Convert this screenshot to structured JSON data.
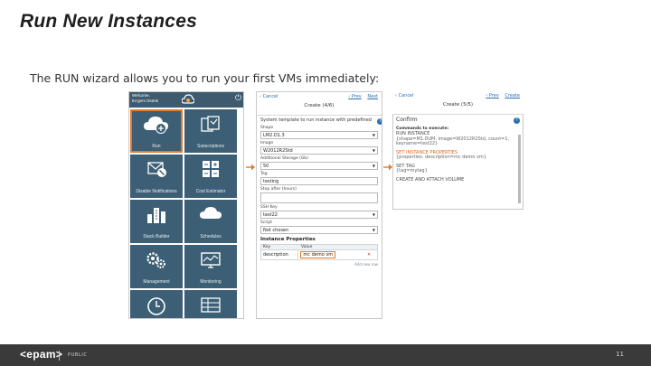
{
  "slide": {
    "title": "Run New Instances",
    "subtitle": "The RUN wizard allows you to run your first VMs immediately:"
  },
  "home_panel": {
    "welcome": "Welcome,",
    "user_name": "Ev'geni Ostrek",
    "tiles": [
      {
        "label": "Run",
        "icon": "cloud-plus-icon",
        "active": true
      },
      {
        "label": "Subscriptions",
        "icon": "subscriptions-icon",
        "active": false
      },
      {
        "label": "Disable Notifications",
        "icon": "notifications-off-icon",
        "active": false
      },
      {
        "label": "Cost Estimator",
        "icon": "calculator-icon",
        "active": false
      },
      {
        "label": "Stack Builder",
        "icon": "stack-builder-icon",
        "active": false
      },
      {
        "label": "Schedules",
        "icon": "cloud-schedule-icon",
        "active": false
      },
      {
        "label": "Management",
        "icon": "gears-icon",
        "active": false
      },
      {
        "label": "Monitoring",
        "icon": "monitor-icon",
        "active": false
      },
      {
        "label": "",
        "icon": "clock-icon",
        "active": false
      },
      {
        "label": "",
        "icon": "table-icon",
        "active": false
      }
    ]
  },
  "form_panel": {
    "nav": {
      "back": "‹ Cancel",
      "title": "Create (4/6)",
      "prev": "‹ Prev",
      "next": "Next"
    },
    "description": "System template to run instance with predefined",
    "fields": [
      {
        "label": "Shape",
        "value": "LM2.D1.3",
        "type": "select"
      },
      {
        "label": "Image",
        "value": "W2012R2Std",
        "type": "select"
      },
      {
        "label": "Additional Storage (Gb)",
        "value": "50",
        "type": "select"
      },
      {
        "label": "Tag",
        "value": "testing",
        "type": "input"
      },
      {
        "label": "Stop after (hours)",
        "value": "",
        "type": "input"
      },
      {
        "label": "SSH Key",
        "value": "test22",
        "type": "select"
      },
      {
        "label": "Script",
        "value": "Not chosen",
        "type": "select"
      }
    ],
    "properties_title": "Instance Properties",
    "properties_table": {
      "headers": [
        "Key",
        "Value"
      ],
      "rows": [
        {
          "key": "description",
          "value": "mc demo vm"
        }
      ]
    },
    "add_new": "Add new row"
  },
  "confirm_panel": {
    "nav": {
      "back": "‹ Cancel",
      "title": "Create (5/5)",
      "prev": "‹ Prev",
      "next": "Create"
    },
    "confirm_label": "Confirm",
    "commands_label": "Commands to execute:",
    "commands": [
      {
        "name": "RUN INSTANCE",
        "detail": "{shape=M1.DUM, image=W2012R2Std, count=1, keyname=test22}",
        "highlight": false
      },
      {
        "name": "SET INSTANCE PROPERTIES",
        "detail": "{properties: description=mc demo vm}",
        "highlight": true
      },
      {
        "name": "SET TAG",
        "detail": "{tag=mytag}",
        "highlight": false
      },
      {
        "name": "CREATE AND ATTACH VOLUME",
        "detail": "",
        "highlight": false
      }
    ]
  },
  "footer": {
    "logo": "<epam>",
    "classification": "PUBLIC",
    "page_number": "11"
  },
  "colors": {
    "tile_bg": "#3c5f76",
    "active_outline": "#e07b2c",
    "arrow": "#e07b2c",
    "footer_bg": "#3a3a3a",
    "link": "#2d6db5"
  }
}
